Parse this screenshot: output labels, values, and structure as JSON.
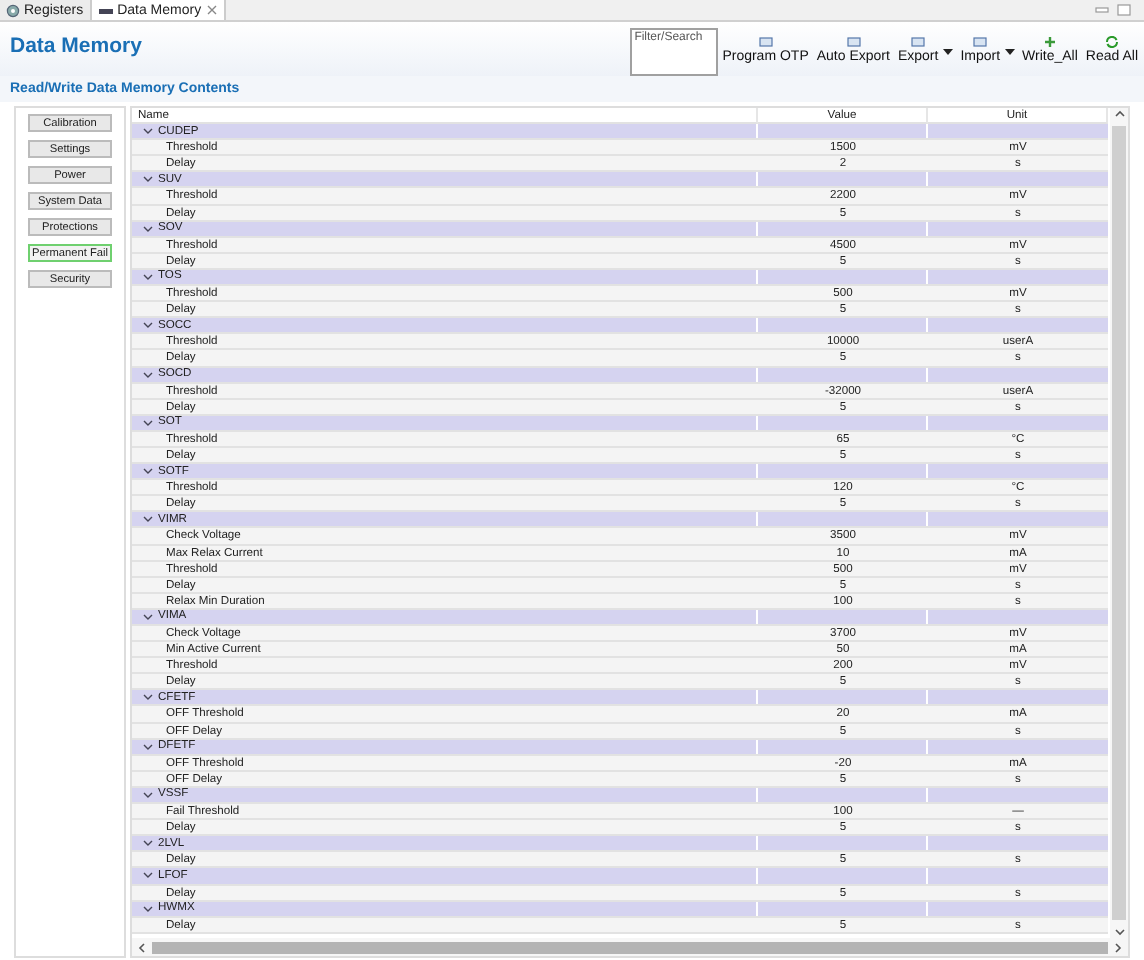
{
  "tabs": [
    {
      "label": "Registers",
      "selected": false,
      "closable": false
    },
    {
      "label": "Data Memory",
      "selected": true,
      "closable": true
    }
  ],
  "title": "Data Memory",
  "filter": {
    "placeholder": "Filter/Search"
  },
  "toolbar": [
    {
      "label": "Program OTP",
      "dropdown": false,
      "kind": "document"
    },
    {
      "label": "Auto Export",
      "dropdown": false,
      "kind": "document"
    },
    {
      "label": "Export",
      "dropdown": true,
      "kind": "document"
    },
    {
      "label": "Import",
      "dropdown": true,
      "kind": "document"
    },
    {
      "label": "Write_All",
      "dropdown": false,
      "kind": "add"
    },
    {
      "label": "Read All",
      "dropdown": false,
      "kind": "refresh"
    }
  ],
  "section_title": "Read/Write Data Memory Contents",
  "sidebar": {
    "items": [
      {
        "label": "Calibration",
        "selected": false
      },
      {
        "label": "Settings",
        "selected": false
      },
      {
        "label": "Power",
        "selected": false
      },
      {
        "label": "System Data",
        "selected": false
      },
      {
        "label": "Protections",
        "selected": false
      },
      {
        "label": "Permanent Fail",
        "selected": true
      },
      {
        "label": "Security",
        "selected": false
      }
    ]
  },
  "table": {
    "columns": [
      "Name",
      "Value",
      "Unit"
    ],
    "groups": [
      {
        "name": "CUDEP",
        "expanded": true,
        "children": [
          {
            "name": "Threshold",
            "value": "1500",
            "unit": "mV"
          },
          {
            "name": "Delay",
            "value": "2",
            "unit": "s"
          }
        ]
      },
      {
        "name": "SUV",
        "expanded": true,
        "children": [
          {
            "name": "Threshold",
            "value": "2200",
            "unit": "mV"
          },
          {
            "name": "Delay",
            "value": "5",
            "unit": "s"
          }
        ]
      },
      {
        "name": "SOV",
        "expanded": true,
        "children": [
          {
            "name": "Threshold",
            "value": "4500",
            "unit": "mV"
          },
          {
            "name": "Delay",
            "value": "5",
            "unit": "s"
          }
        ]
      },
      {
        "name": "TOS",
        "expanded": true,
        "children": [
          {
            "name": "Threshold",
            "value": "500",
            "unit": "mV"
          },
          {
            "name": "Delay",
            "value": "5",
            "unit": "s"
          }
        ]
      },
      {
        "name": "SOCC",
        "expanded": true,
        "children": [
          {
            "name": "Threshold",
            "value": "10000",
            "unit": "userA"
          },
          {
            "name": "Delay",
            "value": "5",
            "unit": "s"
          }
        ]
      },
      {
        "name": "SOCD",
        "expanded": true,
        "children": [
          {
            "name": "Threshold",
            "value": "-32000",
            "unit": "userA"
          },
          {
            "name": "Delay",
            "value": "5",
            "unit": "s"
          }
        ]
      },
      {
        "name": "SOT",
        "expanded": true,
        "children": [
          {
            "name": "Threshold",
            "value": "65",
            "unit": "°C"
          },
          {
            "name": "Delay",
            "value": "5",
            "unit": "s"
          }
        ]
      },
      {
        "name": "SOTF",
        "expanded": true,
        "children": [
          {
            "name": "Threshold",
            "value": "120",
            "unit": "°C"
          },
          {
            "name": "Delay",
            "value": "5",
            "unit": "s"
          }
        ]
      },
      {
        "name": "VIMR",
        "expanded": true,
        "children": [
          {
            "name": "Check Voltage",
            "value": "3500",
            "unit": "mV"
          },
          {
            "name": "Max Relax Current",
            "value": "10",
            "unit": "mA"
          },
          {
            "name": "Threshold",
            "value": "500",
            "unit": "mV"
          },
          {
            "name": "Delay",
            "value": "5",
            "unit": "s"
          },
          {
            "name": "Relax Min Duration",
            "value": "100",
            "unit": "s"
          }
        ]
      },
      {
        "name": "VIMA",
        "expanded": true,
        "children": [
          {
            "name": "Check Voltage",
            "value": "3700",
            "unit": "mV"
          },
          {
            "name": "Min Active Current",
            "value": "50",
            "unit": "mA"
          },
          {
            "name": "Threshold",
            "value": "200",
            "unit": "mV"
          },
          {
            "name": "Delay",
            "value": "5",
            "unit": "s"
          }
        ]
      },
      {
        "name": "CFETF",
        "expanded": true,
        "children": [
          {
            "name": "OFF Threshold",
            "value": "20",
            "unit": "mA"
          },
          {
            "name": "OFF Delay",
            "value": "5",
            "unit": "s"
          }
        ]
      },
      {
        "name": "DFETF",
        "expanded": true,
        "children": [
          {
            "name": "OFF Threshold",
            "value": "-20",
            "unit": "mA"
          },
          {
            "name": "OFF Delay",
            "value": "5",
            "unit": "s"
          }
        ]
      },
      {
        "name": "VSSF",
        "expanded": true,
        "children": [
          {
            "name": "Fail Threshold",
            "value": "100",
            "unit": "—"
          },
          {
            "name": "Delay",
            "value": "5",
            "unit": "s"
          }
        ]
      },
      {
        "name": "2LVL",
        "expanded": true,
        "children": [
          {
            "name": "Delay",
            "value": "5",
            "unit": "s"
          }
        ]
      },
      {
        "name": "LFOF",
        "expanded": true,
        "children": [
          {
            "name": "Delay",
            "value": "5",
            "unit": "s"
          }
        ]
      },
      {
        "name": "HWMX",
        "expanded": true,
        "children": [
          {
            "name": "Delay",
            "value": "5",
            "unit": "s"
          }
        ]
      }
    ]
  }
}
